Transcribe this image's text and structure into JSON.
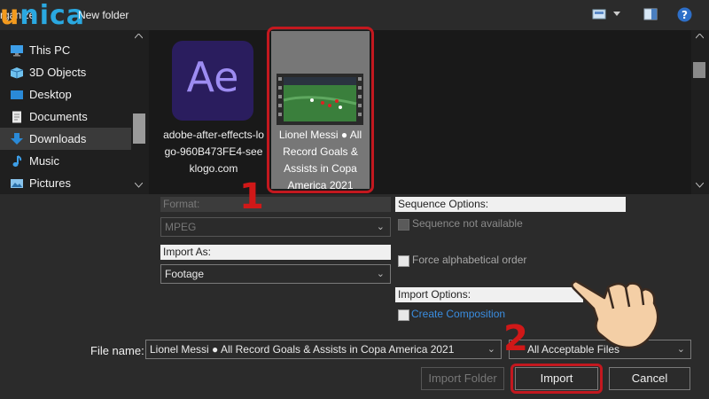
{
  "toolbar": {
    "organize_label": "rganize",
    "new_folder_label": "New folder",
    "logo_u": "u",
    "logo_rest": "nica"
  },
  "nav": {
    "items": [
      {
        "label": "This PC",
        "icon": "computer-icon"
      },
      {
        "label": "3D Objects",
        "icon": "cube-icon"
      },
      {
        "label": "Desktop",
        "icon": "desktop-icon"
      },
      {
        "label": "Documents",
        "icon": "document-icon"
      },
      {
        "label": "Downloads",
        "icon": "download-arrow-icon",
        "selected": true
      },
      {
        "label": "Music",
        "icon": "music-note-icon"
      },
      {
        "label": "Pictures",
        "icon": "pictures-icon"
      }
    ]
  },
  "files": [
    {
      "name": "adobe-after-effects-logo-960B473FE4-seeklogo.com",
      "icon_text": "Ae"
    },
    {
      "name": "Lionel Messi ● All Record Goals & Assists in Copa America 2021",
      "selected": true
    }
  ],
  "options": {
    "format_label": "Format:",
    "format_value": "MPEG",
    "import_as_label": "Import As:",
    "import_as_value": "Footage",
    "sequence_options_label": "Sequence Options:",
    "sequence_checkbox": "Sequence not available",
    "alpha_checkbox": "Force alphabetical order",
    "import_options_label": "Import Options:",
    "create_composition": "Create Composition"
  },
  "filename": {
    "label": "File name:",
    "value": "Lionel Messi ● All Record Goals & Assists in Copa America 2021",
    "filter": "All Acceptable Files"
  },
  "buttons": {
    "import_folder": "Import Folder",
    "import": "Import",
    "cancel": "Cancel"
  },
  "annotations": {
    "step1": "1",
    "step2": "2"
  },
  "colors": {
    "highlight": "#c3181f",
    "link": "#3a8de0",
    "unica_blue": "#2aa8e0",
    "unica_orange": "#f39a1e"
  }
}
